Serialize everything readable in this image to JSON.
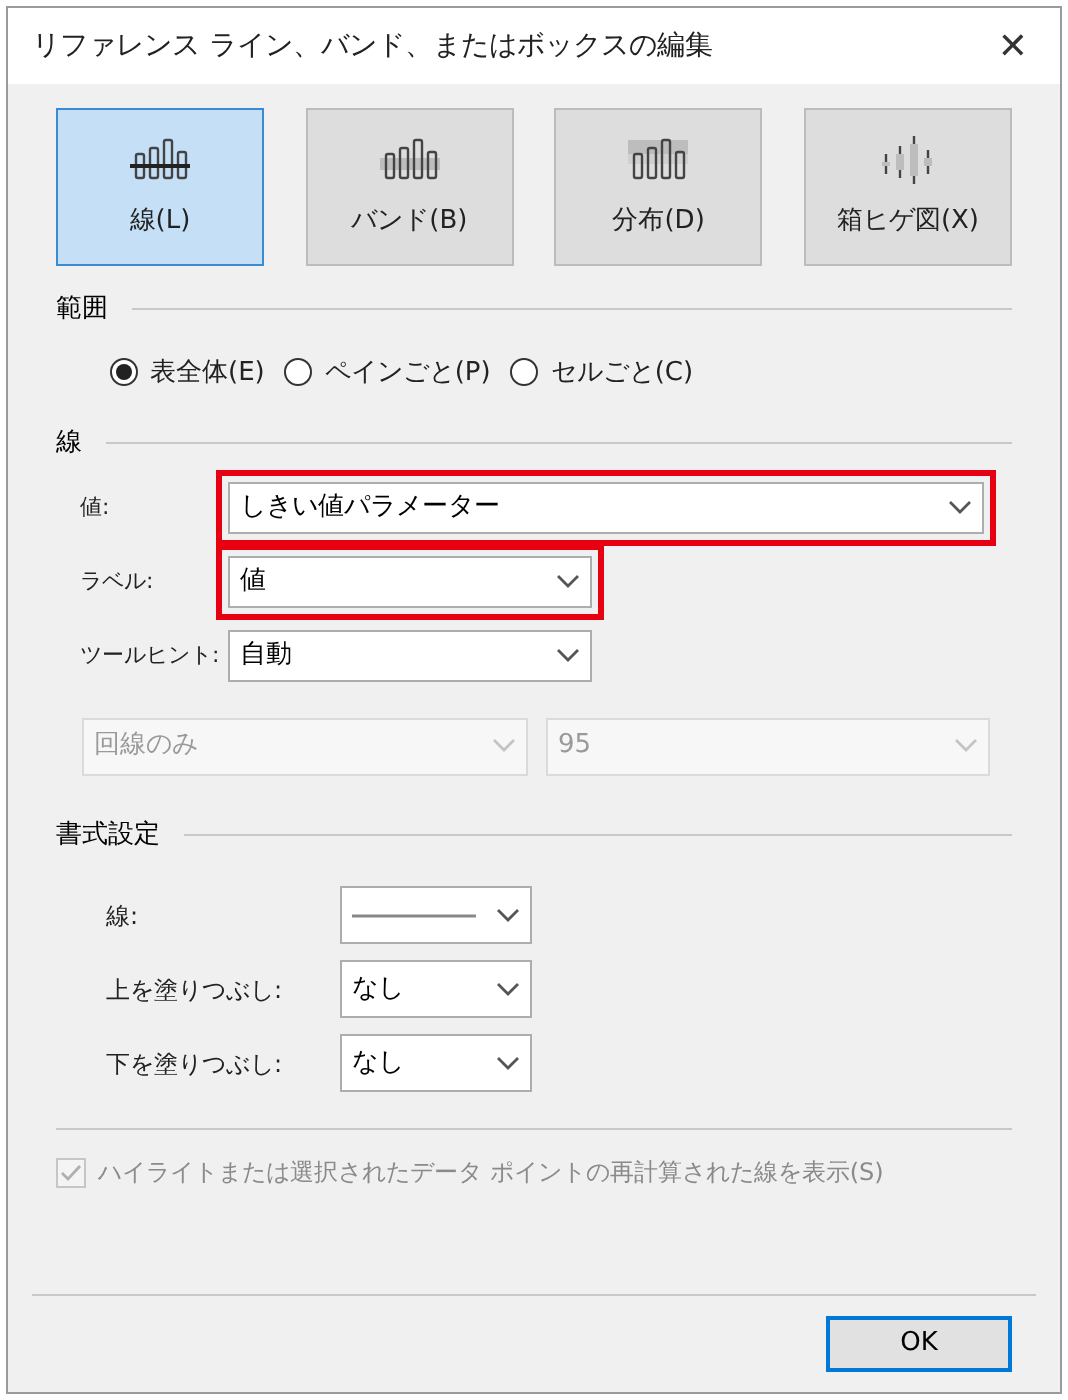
{
  "window": {
    "title": "リファレンス ライン、バンド、またはボックスの編集",
    "close": "✕"
  },
  "types": [
    {
      "label": "線(L)",
      "selected": true,
      "kind": "line"
    },
    {
      "label": "バンド(B)",
      "selected": false,
      "kind": "band"
    },
    {
      "label": "分布(D)",
      "selected": false,
      "kind": "distribution"
    },
    {
      "label": "箱ヒゲ図(X)",
      "selected": false,
      "kind": "box"
    }
  ],
  "scope": {
    "heading": "範囲",
    "options": [
      {
        "label": "表全体(E)",
        "selected": true
      },
      {
        "label": "ペインごと(P)",
        "selected": false
      },
      {
        "label": "セルごと(C)",
        "selected": false
      }
    ]
  },
  "line": {
    "heading": "線",
    "fields": [
      {
        "label": "値:",
        "value": "しきい値パラメーター",
        "highlighted": true,
        "wide": true
      },
      {
        "label": "ラベル:",
        "value": "値",
        "highlighted": true,
        "wide": false
      },
      {
        "label": "ツールヒント:",
        "value": "自動",
        "highlighted": false,
        "wide": false
      }
    ],
    "disabled_fields": [
      {
        "value": "回線のみ"
      },
      {
        "value": "95"
      }
    ]
  },
  "format": {
    "heading": "書式設定",
    "fields": [
      {
        "label": "線:",
        "kind": "line_style"
      },
      {
        "label": "上を塗りつぶし:",
        "kind": "text",
        "value": "なし"
      },
      {
        "label": "下を塗りつぶし:",
        "kind": "text",
        "value": "なし"
      }
    ]
  },
  "recalc": {
    "label": "ハイライトまたは選択されたデータ ポイントの再計算された線を表示(S)",
    "checked": true,
    "disabled": true
  },
  "ok": "OK"
}
